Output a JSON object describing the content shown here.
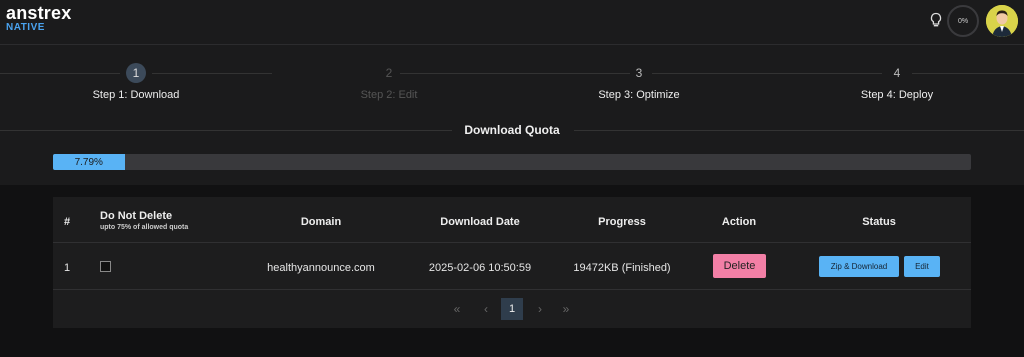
{
  "header": {
    "brand": "anstrex",
    "sub": "NATIVE",
    "meter_label": "0%"
  },
  "steps": [
    {
      "num": "1",
      "label": "Step 1: Download",
      "state": "active"
    },
    {
      "num": "2",
      "label": "Step 2: Edit",
      "state": "disabled"
    },
    {
      "num": "3",
      "label": "Step 3: Optimize",
      "state": "normal"
    },
    {
      "num": "4",
      "label": "Step 4: Deploy",
      "state": "normal"
    }
  ],
  "quota": {
    "title": "Download Quota",
    "label": "7.79%",
    "value": 0.0779
  },
  "table": {
    "headers": {
      "index": "#",
      "do_not_delete": "Do Not Delete",
      "do_not_delete_note": "upto 75% of allowed quota",
      "domain": "Domain",
      "download_date": "Download Date",
      "progress": "Progress",
      "action": "Action",
      "status": "Status"
    },
    "rows": [
      {
        "index": "1",
        "domain": "healthyannounce.com",
        "download_date": "2025-02-06 10:50:59",
        "progress": "19472KB (Finished)",
        "action_label": "Delete",
        "zip_label": "Zip & Download",
        "edit_label": "Edit"
      }
    ]
  },
  "pagination": {
    "first": "«",
    "prev": "‹",
    "current": "1",
    "next": "›",
    "last": "»"
  },
  "colors": {
    "accent": "#59b3f5",
    "delete": "#f27fa6",
    "background": "#111112",
    "panel": "#1d1d1e"
  },
  "icons": {
    "bulb": "lightbulb-icon",
    "avatar": "user-avatar"
  }
}
